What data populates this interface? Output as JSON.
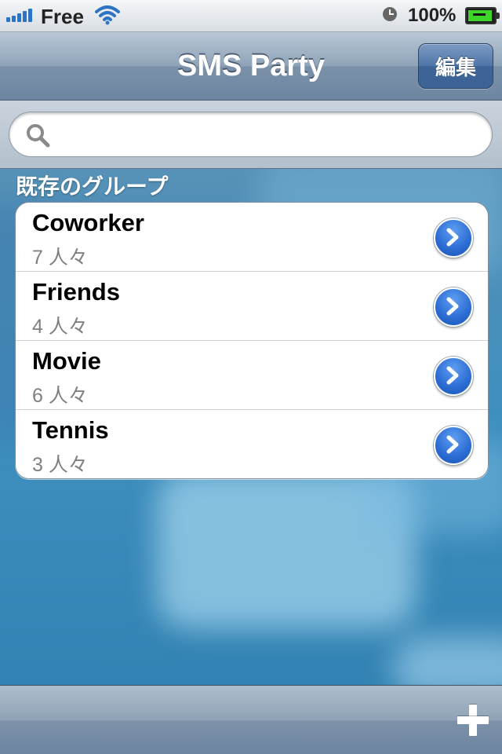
{
  "status_bar": {
    "carrier": "Free",
    "battery_percent": "100%",
    "signal_bars": 5,
    "icons": [
      "signal-icon",
      "wifi-icon",
      "clock-icon",
      "battery-charging-icon"
    ]
  },
  "nav_bar": {
    "title": "SMS Party",
    "edit_label": "編集"
  },
  "search": {
    "placeholder": "",
    "value": ""
  },
  "groups_section": {
    "header": "既存のグループ",
    "items": [
      {
        "name": "Coworker",
        "count": "7 人々"
      },
      {
        "name": "Friends",
        "count": "4 人々"
      },
      {
        "name": "Movie",
        "count": "6 人々"
      },
      {
        "name": "Tennis",
        "count": "3 人々"
      }
    ]
  },
  "toolbar": {
    "add_icon": "plus-icon"
  },
  "colors": {
    "accent": "#2e6fd6",
    "nav_bar": "#8fa3b8",
    "background": "#3f8fbf"
  }
}
